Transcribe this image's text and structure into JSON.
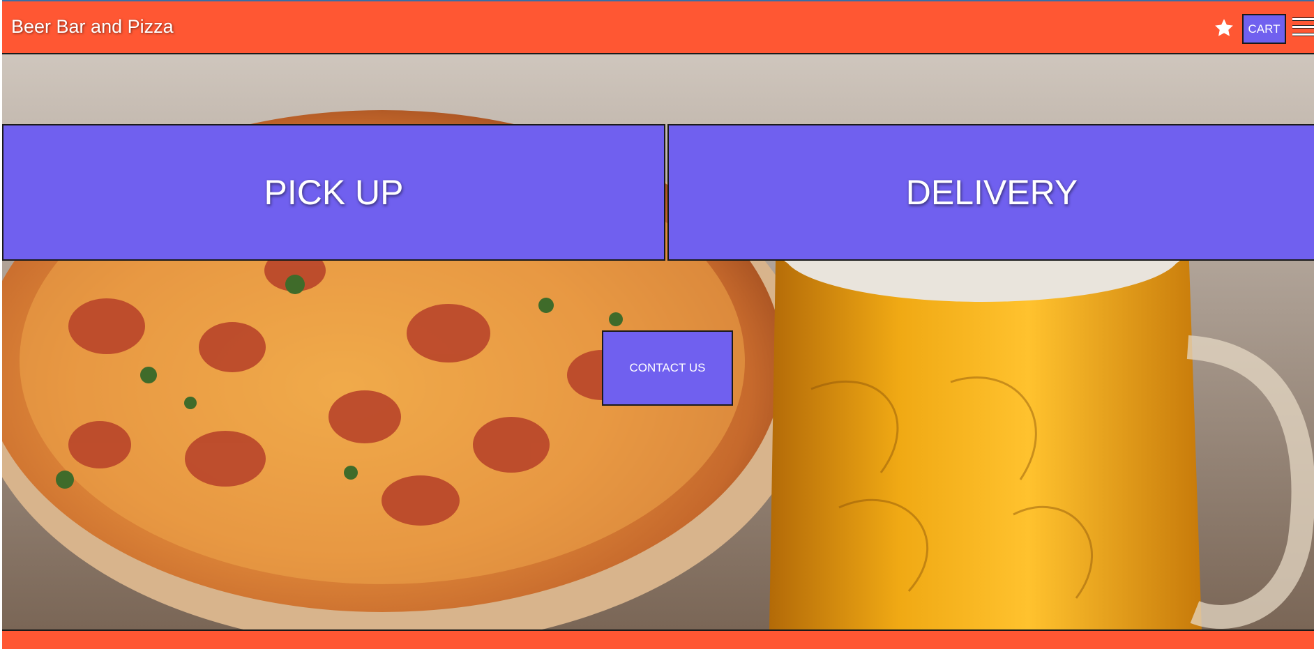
{
  "header": {
    "title": "Beer Bar and Pizza",
    "favorite_icon": "star-icon",
    "cart_label": "CART",
    "menu_icon": "hamburger-menu-icon"
  },
  "hero": {
    "image_subject": "pepperoni pizza and mug of beer",
    "pickup_label": "PICK UP",
    "delivery_label": "DELIVERY",
    "contact_label": "CONTACT US"
  },
  "colors": {
    "header_bg": "#ff5733",
    "button_bg": "#7060ef",
    "text": "#ffffff",
    "border": "#1a1a1a"
  }
}
